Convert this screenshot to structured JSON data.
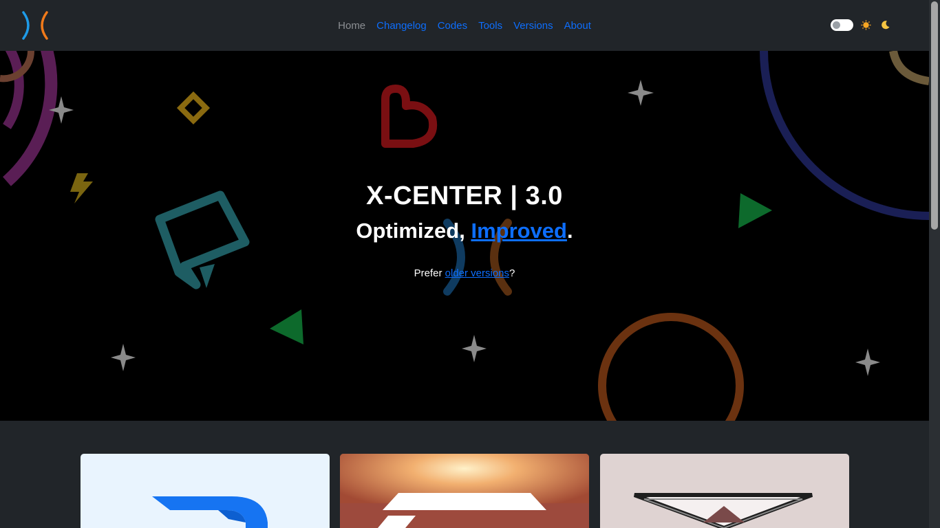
{
  "nav": {
    "links": [
      {
        "label": "Home",
        "active": true
      },
      {
        "label": "Changelog",
        "active": false
      },
      {
        "label": "Codes",
        "active": false
      },
      {
        "label": "Tools",
        "active": false
      },
      {
        "label": "Versions",
        "active": false
      },
      {
        "label": "About",
        "active": false
      }
    ],
    "logo_icon": "x-center-logo-icon",
    "theme_toggle_icon": "toggle-switch-icon",
    "sun_icon": "sun-icon",
    "moon_icon": "moon-icon"
  },
  "hero": {
    "title": "X-CENTER | 3.0",
    "subtitle_prefix": "Optimized, ",
    "subtitle_link": "Improved",
    "subtitle_suffix": ".",
    "prefer_prefix": "Prefer ",
    "prefer_link": "older versions",
    "prefer_suffix": "?"
  },
  "cards": [
    {
      "icon": "blue-app-logo-icon"
    },
    {
      "icon": "sunset-landscape-logo-icon"
    },
    {
      "icon": "mountain-triangle-logo-icon"
    }
  ],
  "colors": {
    "navbar_bg": "#212529",
    "link": "#0d6efd",
    "active_link": "#8c8f93",
    "hero_bg": "#000000"
  }
}
